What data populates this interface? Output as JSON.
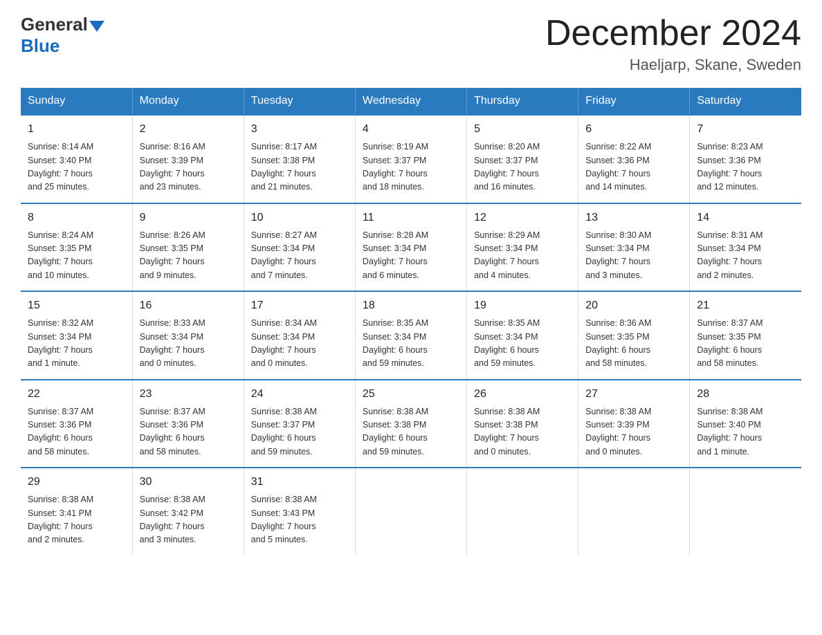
{
  "logo": {
    "general": "General",
    "blue": "Blue"
  },
  "title": "December 2024",
  "location": "Haeljarp, Skane, Sweden",
  "weekdays": [
    "Sunday",
    "Monday",
    "Tuesday",
    "Wednesday",
    "Thursday",
    "Friday",
    "Saturday"
  ],
  "weeks": [
    [
      {
        "day": "1",
        "sunrise": "8:14 AM",
        "sunset": "3:40 PM",
        "daylight": "7 hours and 25 minutes."
      },
      {
        "day": "2",
        "sunrise": "8:16 AM",
        "sunset": "3:39 PM",
        "daylight": "7 hours and 23 minutes."
      },
      {
        "day": "3",
        "sunrise": "8:17 AM",
        "sunset": "3:38 PM",
        "daylight": "7 hours and 21 minutes."
      },
      {
        "day": "4",
        "sunrise": "8:19 AM",
        "sunset": "3:37 PM",
        "daylight": "7 hours and 18 minutes."
      },
      {
        "day": "5",
        "sunrise": "8:20 AM",
        "sunset": "3:37 PM",
        "daylight": "7 hours and 16 minutes."
      },
      {
        "day": "6",
        "sunrise": "8:22 AM",
        "sunset": "3:36 PM",
        "daylight": "7 hours and 14 minutes."
      },
      {
        "day": "7",
        "sunrise": "8:23 AM",
        "sunset": "3:36 PM",
        "daylight": "7 hours and 12 minutes."
      }
    ],
    [
      {
        "day": "8",
        "sunrise": "8:24 AM",
        "sunset": "3:35 PM",
        "daylight": "7 hours and 10 minutes."
      },
      {
        "day": "9",
        "sunrise": "8:26 AM",
        "sunset": "3:35 PM",
        "daylight": "7 hours and 9 minutes."
      },
      {
        "day": "10",
        "sunrise": "8:27 AM",
        "sunset": "3:34 PM",
        "daylight": "7 hours and 7 minutes."
      },
      {
        "day": "11",
        "sunrise": "8:28 AM",
        "sunset": "3:34 PM",
        "daylight": "7 hours and 6 minutes."
      },
      {
        "day": "12",
        "sunrise": "8:29 AM",
        "sunset": "3:34 PM",
        "daylight": "7 hours and 4 minutes."
      },
      {
        "day": "13",
        "sunrise": "8:30 AM",
        "sunset": "3:34 PM",
        "daylight": "7 hours and 3 minutes."
      },
      {
        "day": "14",
        "sunrise": "8:31 AM",
        "sunset": "3:34 PM",
        "daylight": "7 hours and 2 minutes."
      }
    ],
    [
      {
        "day": "15",
        "sunrise": "8:32 AM",
        "sunset": "3:34 PM",
        "daylight": "7 hours and 1 minute."
      },
      {
        "day": "16",
        "sunrise": "8:33 AM",
        "sunset": "3:34 PM",
        "daylight": "7 hours and 0 minutes."
      },
      {
        "day": "17",
        "sunrise": "8:34 AM",
        "sunset": "3:34 PM",
        "daylight": "7 hours and 0 minutes."
      },
      {
        "day": "18",
        "sunrise": "8:35 AM",
        "sunset": "3:34 PM",
        "daylight": "6 hours and 59 minutes."
      },
      {
        "day": "19",
        "sunrise": "8:35 AM",
        "sunset": "3:34 PM",
        "daylight": "6 hours and 59 minutes."
      },
      {
        "day": "20",
        "sunrise": "8:36 AM",
        "sunset": "3:35 PM",
        "daylight": "6 hours and 58 minutes."
      },
      {
        "day": "21",
        "sunrise": "8:37 AM",
        "sunset": "3:35 PM",
        "daylight": "6 hours and 58 minutes."
      }
    ],
    [
      {
        "day": "22",
        "sunrise": "8:37 AM",
        "sunset": "3:36 PM",
        "daylight": "6 hours and 58 minutes."
      },
      {
        "day": "23",
        "sunrise": "8:37 AM",
        "sunset": "3:36 PM",
        "daylight": "6 hours and 58 minutes."
      },
      {
        "day": "24",
        "sunrise": "8:38 AM",
        "sunset": "3:37 PM",
        "daylight": "6 hours and 59 minutes."
      },
      {
        "day": "25",
        "sunrise": "8:38 AM",
        "sunset": "3:38 PM",
        "daylight": "6 hours and 59 minutes."
      },
      {
        "day": "26",
        "sunrise": "8:38 AM",
        "sunset": "3:38 PM",
        "daylight": "7 hours and 0 minutes."
      },
      {
        "day": "27",
        "sunrise": "8:38 AM",
        "sunset": "3:39 PM",
        "daylight": "7 hours and 0 minutes."
      },
      {
        "day": "28",
        "sunrise": "8:38 AM",
        "sunset": "3:40 PM",
        "daylight": "7 hours and 1 minute."
      }
    ],
    [
      {
        "day": "29",
        "sunrise": "8:38 AM",
        "sunset": "3:41 PM",
        "daylight": "7 hours and 2 minutes."
      },
      {
        "day": "30",
        "sunrise": "8:38 AM",
        "sunset": "3:42 PM",
        "daylight": "7 hours and 3 minutes."
      },
      {
        "day": "31",
        "sunrise": "8:38 AM",
        "sunset": "3:43 PM",
        "daylight": "7 hours and 5 minutes."
      },
      null,
      null,
      null,
      null
    ]
  ],
  "labels": {
    "sunrise": "Sunrise:",
    "sunset": "Sunset:",
    "daylight": "Daylight:"
  }
}
